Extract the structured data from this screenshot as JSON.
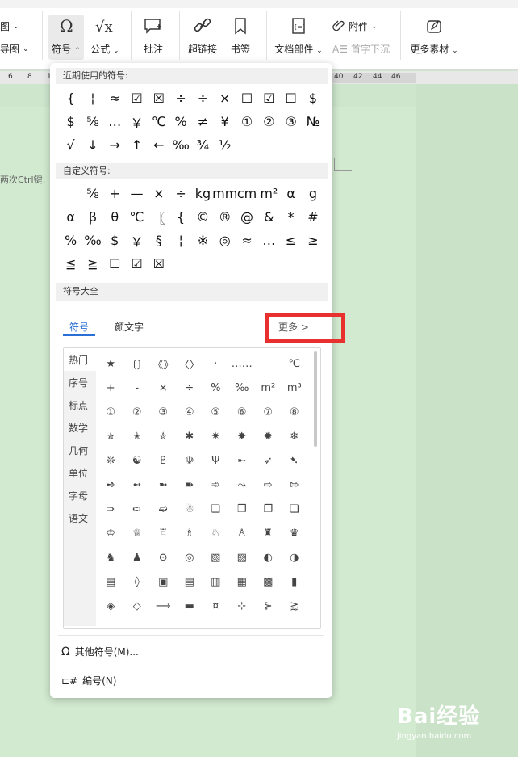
{
  "ribbon": {
    "left_top": "图",
    "left_bottom": "导图",
    "symbol_label": "符号",
    "formula_label": "公式",
    "comment_label": "批注",
    "hyperlink_label": "超链接",
    "bookmark_label": "书签",
    "docpart_label": "文档部件",
    "attachment_label": "附件",
    "dropcap_label": "首字下沉",
    "material_label": "更多素材"
  },
  "ruler": [
    "6",
    "8",
    "1",
    "40",
    "42",
    "44",
    "46"
  ],
  "doc": {
    "text": "两次Ctrl键,"
  },
  "panel": {
    "recent_title": "近期使用的符号:",
    "recent_symbols": [
      "{",
      "¦",
      "≈",
      "☑",
      "☒",
      "÷",
      "÷",
      "×",
      "☐",
      "☑",
      "☐",
      "$",
      "$",
      "⅝",
      "…",
      "￥",
      "℃",
      "%",
      "≠",
      "¥",
      "①",
      "②",
      "③",
      "№",
      "√",
      "↓",
      "→",
      "↑",
      "←",
      "‰",
      "¾",
      "½"
    ],
    "custom_title": "自定义符号:",
    "custom_symbols": [
      "",
      "⅝",
      "+",
      "—",
      "×",
      "÷",
      "kg",
      "mm",
      "cm",
      "m²",
      "α",
      "g",
      "α",
      "β",
      "θ",
      "℃",
      "〖",
      "{",
      "©",
      "®",
      "@",
      "&",
      "*",
      "#",
      "%",
      "‰",
      "$",
      "￥",
      "§",
      "¦",
      "※",
      "◎",
      "≈",
      "…",
      "≤",
      "≥",
      "≦",
      "≧",
      "☐",
      "☑",
      "☒"
    ],
    "all_title": "符号大全",
    "tabs": [
      "符号",
      "颜文字"
    ],
    "more_label": "更多 >",
    "categories": [
      "热门",
      "序号",
      "标点",
      "数学",
      "几何",
      "单位",
      "字母",
      "语文"
    ],
    "grid_symbols": [
      "★",
      "〔〕",
      "《》",
      "〈〉",
      "·",
      "……",
      "——",
      "℃",
      "+",
      "-",
      "×",
      "÷",
      "%",
      "‰",
      "m²",
      "m³",
      "①",
      "②",
      "③",
      "④",
      "⑤",
      "⑥",
      "⑦",
      "⑧",
      "✯",
      "✭",
      "✮",
      "✱",
      "✷",
      "✸",
      "✹",
      "❄",
      "❊",
      "☯",
      "♇",
      "☫",
      "Ψ",
      "➸",
      "➶",
      "➷",
      "➺",
      "➻",
      "➼",
      "➽",
      "➾",
      "⤳",
      "⇨",
      "⇰",
      "➩",
      "➪",
      "➫",
      "☃",
      "❑",
      "❒",
      "❐",
      "❏",
      "♔",
      "♕",
      "♖",
      "♗",
      "♘",
      "♙",
      "♜",
      "♛",
      "♞",
      "♟",
      "⊙",
      "◎",
      "▧",
      "▨",
      "◐",
      "◑",
      "▤",
      "◊",
      "▣",
      "▤",
      "▥",
      "▦",
      "▩",
      "▮",
      "◈",
      "◇",
      "⟶",
      "▬",
      "¤",
      "⊹",
      "⊱",
      "⪆"
    ],
    "other_symbols_label": "其他符号(M)...",
    "numbering_label": "编号(N)"
  },
  "watermark": {
    "brand": "Bai经验",
    "url": "jingyan.baidu.com"
  },
  "colors": {
    "accent": "#2a6fd6",
    "highlight": "#e8312f",
    "doc_bg": "#d2ead0"
  }
}
